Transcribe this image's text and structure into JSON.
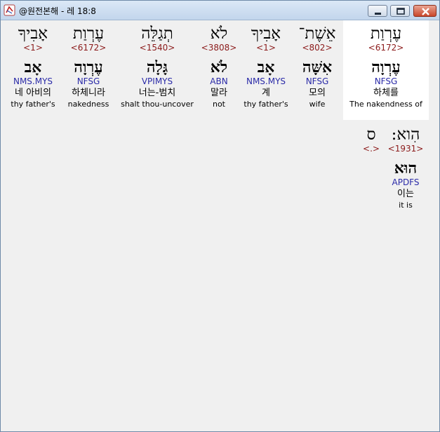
{
  "window": {
    "title": "@원전본해 - 레 18:8",
    "icons": {
      "app": "app-icon",
      "minimize": "minimize-icon",
      "maximize": "maximize-icon",
      "close": "close-icon"
    }
  },
  "words": [
    {
      "hebrew": "עֶרְוַת",
      "strong": "<6172>",
      "lemma": "עֶרְוָה",
      "morph": "NFSG",
      "korean": "하체를",
      "english": "The nakendness of"
    },
    {
      "hebrew": "אֵשֶׁת־",
      "strong": "<802>",
      "lemma": "אִשָּׁה",
      "morph": "NFSG",
      "korean": "모의",
      "english": "wife"
    },
    {
      "hebrew": "אָבִיךָ",
      "strong": "<1>",
      "lemma": "אָב",
      "morph": "NMS.MYS",
      "korean": "계",
      "english": "thy father's"
    },
    {
      "hebrew": "לֹא",
      "strong": "<3808>",
      "lemma": "לֹא",
      "morph": "ABN",
      "korean": "말라",
      "english": "not"
    },
    {
      "hebrew": "תְגַלֵּה",
      "strong": "<1540>",
      "lemma": "גָּלָה",
      "morph": "VPIMYS",
      "korean": "너는-범치",
      "english": "shalt thou-uncover"
    },
    {
      "hebrew": "עֶרְוַת",
      "strong": "<6172>",
      "lemma": "עֶרְוָה",
      "morph": "NFSG",
      "korean": "하체니라",
      "english": "nakedness"
    },
    {
      "hebrew": "אָבִיךָ",
      "strong": "<1>",
      "lemma": "אָב",
      "morph": "NMS.MYS",
      "korean": "네 아비의",
      "english": "thy father's"
    },
    {
      "hebrew": "הִוא:",
      "strong": "<1931>",
      "lemma": "הוּא",
      "morph": "APDFS",
      "korean": "이는",
      "english": "it is"
    },
    {
      "hebrew": "ס",
      "strong": "<.>",
      "lemma": "",
      "morph": "",
      "korean": "",
      "english": ""
    }
  ]
}
